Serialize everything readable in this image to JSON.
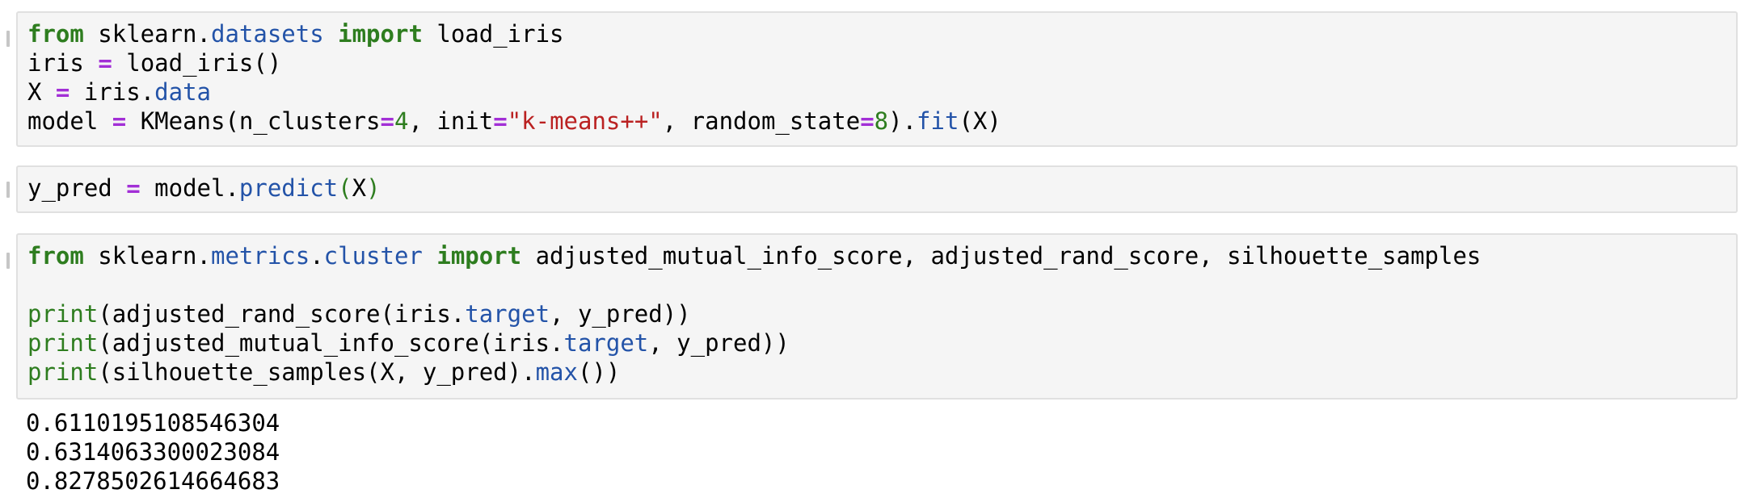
{
  "cells": [
    {
      "lines": [
        [
          {
            "t": "from",
            "c": "kw"
          },
          {
            "t": " sklearn.",
            "c": ""
          },
          {
            "t": "datasets",
            "c": "attr"
          },
          {
            "t": " ",
            "c": ""
          },
          {
            "t": "import",
            "c": "kw"
          },
          {
            "t": " load_iris",
            "c": ""
          }
        ],
        [
          {
            "t": "iris ",
            "c": ""
          },
          {
            "t": "=",
            "c": "op"
          },
          {
            "t": " load_iris()",
            "c": ""
          }
        ],
        [
          {
            "t": "X ",
            "c": ""
          },
          {
            "t": "=",
            "c": "op"
          },
          {
            "t": " iris.",
            "c": ""
          },
          {
            "t": "data",
            "c": "attr"
          }
        ],
        [
          {
            "t": "model ",
            "c": ""
          },
          {
            "t": "=",
            "c": "op"
          },
          {
            "t": " KMeans(n_clusters",
            "c": ""
          },
          {
            "t": "=",
            "c": "op"
          },
          {
            "t": "4",
            "c": "num"
          },
          {
            "t": ", init",
            "c": ""
          },
          {
            "t": "=",
            "c": "op"
          },
          {
            "t": "\"k-means++\"",
            "c": "str"
          },
          {
            "t": ", random_state",
            "c": ""
          },
          {
            "t": "=",
            "c": "op"
          },
          {
            "t": "8",
            "c": "num"
          },
          {
            "t": ").",
            "c": ""
          },
          {
            "t": "fit",
            "c": "attr"
          },
          {
            "t": "(X)",
            "c": ""
          }
        ]
      ]
    },
    {
      "lines": [
        [
          {
            "t": "y_pred ",
            "c": ""
          },
          {
            "t": "=",
            "c": "op"
          },
          {
            "t": " model.",
            "c": ""
          },
          {
            "t": "predict",
            "c": "attr"
          },
          {
            "t": "(",
            "c": "par-g"
          },
          {
            "t": "X",
            "c": ""
          },
          {
            "t": ")",
            "c": "par-g"
          }
        ]
      ]
    },
    {
      "lines": [
        [
          {
            "t": "from",
            "c": "kw"
          },
          {
            "t": " sklearn.",
            "c": ""
          },
          {
            "t": "metrics",
            "c": "attr"
          },
          {
            "t": ".",
            "c": ""
          },
          {
            "t": "cluster",
            "c": "attr"
          },
          {
            "t": " ",
            "c": ""
          },
          {
            "t": "import",
            "c": "kw"
          },
          {
            "t": " adjusted_mutual_info_score, adjusted_rand_score, silhouette_samples",
            "c": ""
          }
        ],
        [
          {
            "t": "",
            "c": ""
          }
        ],
        [
          {
            "t": "print",
            "c": "bi"
          },
          {
            "t": "(adjusted_rand_score(iris.",
            "c": ""
          },
          {
            "t": "target",
            "c": "attr"
          },
          {
            "t": ", y_pred))",
            "c": ""
          }
        ],
        [
          {
            "t": "print",
            "c": "bi"
          },
          {
            "t": "(adjusted_mutual_info_score(iris.",
            "c": ""
          },
          {
            "t": "target",
            "c": "attr"
          },
          {
            "t": ", y_pred))",
            "c": ""
          }
        ],
        [
          {
            "t": "print",
            "c": "bi"
          },
          {
            "t": "(silhouette_samples(X, y_pred).",
            "c": ""
          },
          {
            "t": "max",
            "c": "attr"
          },
          {
            "t": "())",
            "c": ""
          }
        ]
      ]
    }
  ],
  "output": {
    "lines": [
      "0.6110195108546304",
      "0.6314063300023084",
      "0.8278502614664683"
    ]
  }
}
